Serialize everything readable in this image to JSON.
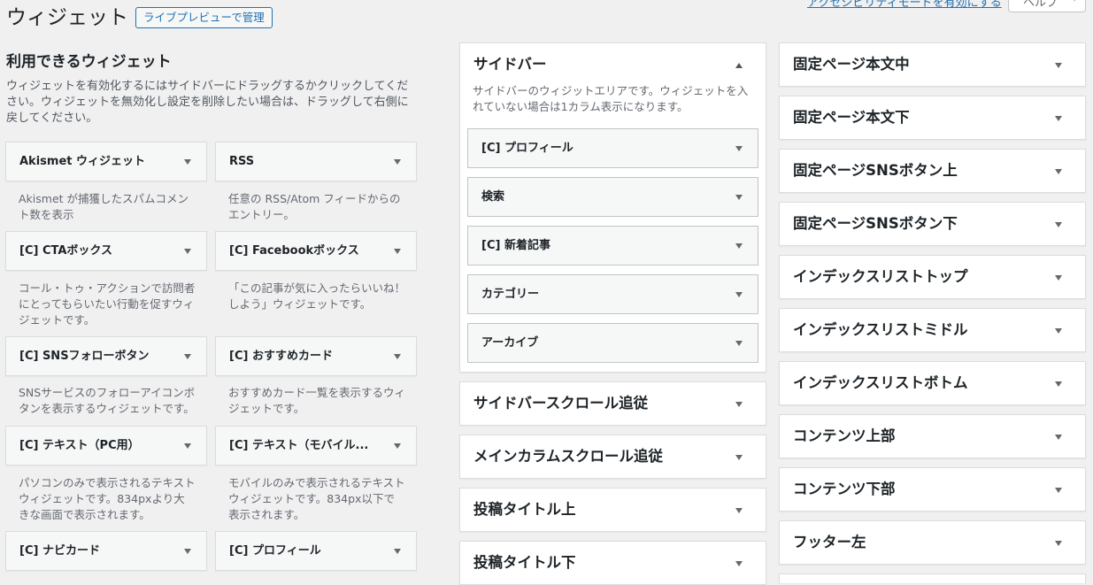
{
  "header": {
    "title": "ウィジェット",
    "live_preview_button": "ライブプレビューで管理",
    "a11y_link": "アクセシビリティモードを有効にする",
    "help_button": "ヘルプ"
  },
  "available": {
    "heading": "利用できるウィジェット",
    "description": "ウィジェットを有効化するにはサイドバーにドラッグするかクリックしてください。ウィジェットを無効化し設定を削除したい場合は、ドラッグして右側に戻してください。",
    "widgets": [
      {
        "title": "Akismet ウィジェット",
        "desc": "Akismet が捕獲したスパムコメント数を表示"
      },
      {
        "title": "RSS",
        "desc": "任意の RSS/Atom フィードからのエントリー。"
      },
      {
        "title": "[C] CTAボックス",
        "desc": "コール・トゥ・アクションで訪問者にとってもらいたい行動を促すウィジェットです。"
      },
      {
        "title": "[C] Facebookボックス",
        "desc": "「この記事が気に入ったらいいね！しよう」ウィジェットです。"
      },
      {
        "title": "[C] SNSフォローボタン",
        "desc": "SNSサービスのフォローアイコンボタンを表示するウィジェットです。"
      },
      {
        "title": "[C] おすすめカード",
        "desc": "おすすめカード一覧を表示するウィジェットです。"
      },
      {
        "title": "[C] テキスト（PC用）",
        "desc": "パソコンのみで表示されるテキストウィジェットです。834pxより大きな画面で表示されます。"
      },
      {
        "title": "[C] テキスト（モバイル...",
        "desc": "モバイルのみで表示されるテキストウィジェットです。834px以下で表示されます。"
      },
      {
        "title": "[C] ナビカード",
        "desc": ""
      },
      {
        "title": "[C] プロフィール",
        "desc": ""
      }
    ]
  },
  "middle_column": {
    "sidebar": {
      "title": "サイドバー",
      "description": "サイドバーのウィジットエリアです。ウィジェットを入れていない場合は1カラム表示になります。",
      "widgets": [
        {
          "title": "[C] プロフィール"
        },
        {
          "title": "検索"
        },
        {
          "title": "[C] 新着記事"
        },
        {
          "title": "カテゴリー"
        },
        {
          "title": "アーカイブ"
        }
      ]
    },
    "areas": [
      {
        "title": "サイドバースクロール追従"
      },
      {
        "title": "メインカラムスクロール追従"
      },
      {
        "title": "投稿タイトル上"
      },
      {
        "title": "投稿タイトル下"
      }
    ]
  },
  "right_column": {
    "areas": [
      {
        "title": "固定ページ本文中"
      },
      {
        "title": "固定ページ本文下"
      },
      {
        "title": "固定ページSNSボタン上"
      },
      {
        "title": "固定ページSNSボタン下"
      },
      {
        "title": "インデックスリストトップ"
      },
      {
        "title": "インデックスリストミドル"
      },
      {
        "title": "インデックスリストボトム"
      },
      {
        "title": "コンテンツ上部"
      },
      {
        "title": "コンテンツ下部"
      },
      {
        "title": "フッター左"
      },
      {
        "title": ""
      }
    ]
  },
  "colors": {
    "background": "#f0f0f1",
    "accent": "#2271b1",
    "box_border": "#dcdcde"
  }
}
